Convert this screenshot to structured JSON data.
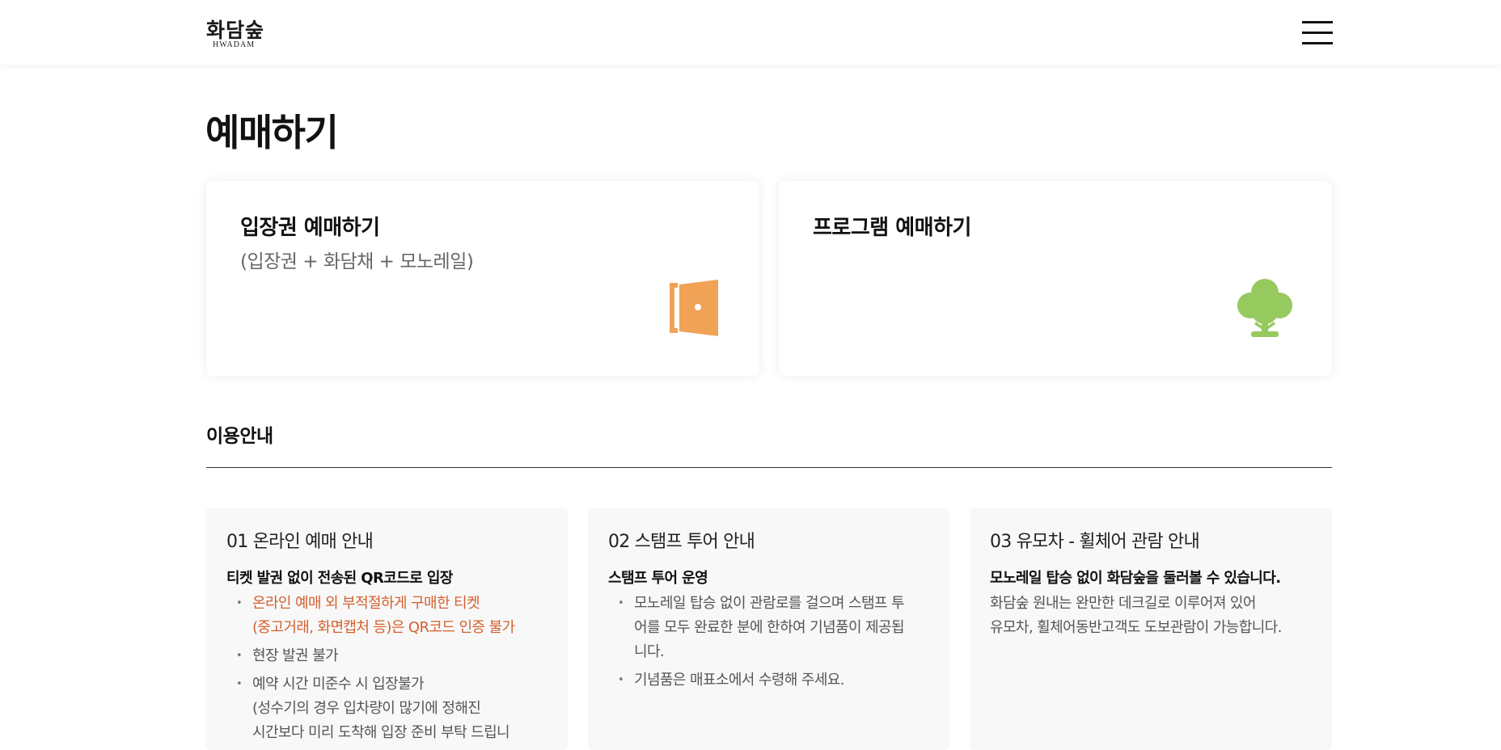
{
  "header": {
    "logo_ko": "화담숲",
    "logo_en": "HWADAM",
    "menu_icon": "hamburger-menu-icon"
  },
  "page_title": "예매하기",
  "cards": [
    {
      "title": "입장권 예매하기",
      "subtitle": "(입장권 + 화담채 + 모노레일)",
      "icon": "door-icon",
      "color": "#f0a257"
    },
    {
      "title": "프로그램 예매하기",
      "subtitle": "",
      "icon": "tree-icon",
      "color": "#96c95e"
    }
  ],
  "guide": {
    "title": "이용안내",
    "sections": [
      {
        "title": "01 온라인 예매 안내",
        "subtitle": "티켓 발권 없이 전송된 QR코드로 입장",
        "items": [
          {
            "lines": [
              "온라인 예매 외 부적절하게 구매한 티켓",
              "(중고거래, 화면캡처 등)은 QR코드 인증 불가"
            ],
            "highlight": true
          },
          {
            "lines": [
              "현장 발권 불가"
            ],
            "highlight": false
          },
          {
            "lines": [
              "예약 시간 미준수 시 입장불가",
              "(성수기의 경우 입차량이 많기에 정해진",
              "시간보다 미리 도착해 입장 준비 부탁 드립니"
            ],
            "highlight": false
          }
        ]
      },
      {
        "title": "02 스탬프 투어 안내",
        "subtitle": "스탬프 투어 운영",
        "items": [
          {
            "lines": [
              "모노레일 탑승 없이 관람로를 걸으며 스탬프 투",
              "어를 모두 완료한 분에 한하여 기념품이 제공됩",
              "니다."
            ],
            "highlight": false
          },
          {
            "lines": [
              "기념품은 매표소에서 수령해 주세요."
            ],
            "highlight": false
          }
        ]
      },
      {
        "title": "03 유모차 - 휠체어 관람 안내",
        "subtitle": "모노레일 탑승 없이 화담숲을 둘러볼 수 있습니다.",
        "text_lines": [
          "화담숲 원내는 완만한 데크길로 이루어져 있어",
          "유모차, 휠체어동반고객도 도보관람이 가능합니다."
        ]
      }
    ]
  },
  "colors": {
    "accent_orange": "#f0a257",
    "accent_green": "#96c95e",
    "warning_text": "#d4602d",
    "info_bg": "#f8f8f8"
  }
}
